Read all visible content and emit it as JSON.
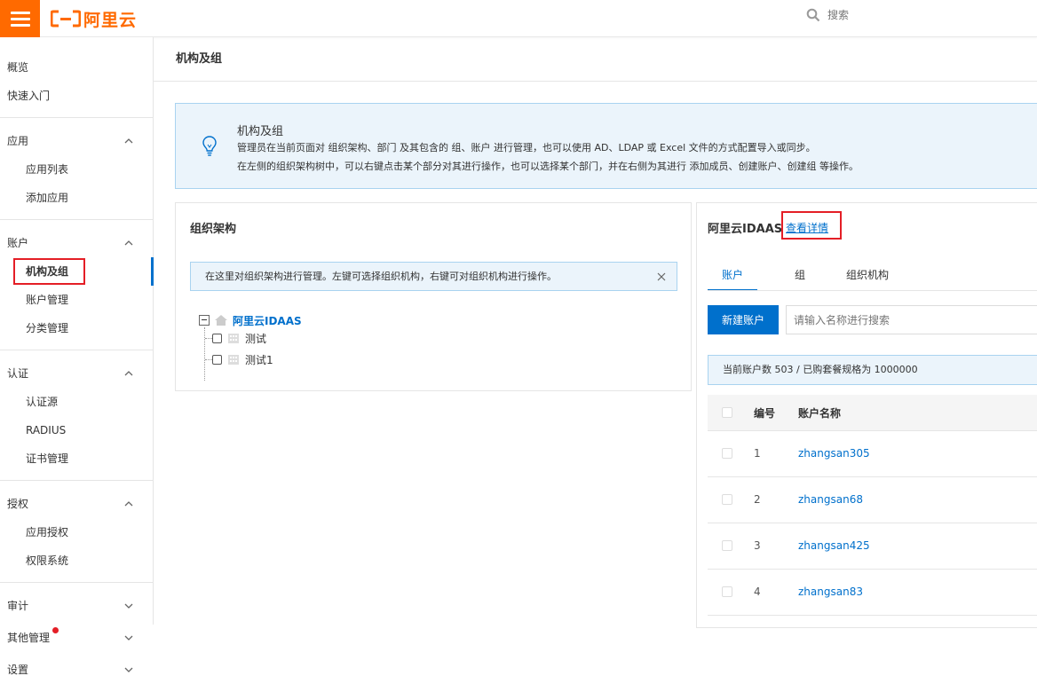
{
  "brand": {
    "name": "阿里云",
    "color": "#ff6a00"
  },
  "search": {
    "placeholder": "搜索"
  },
  "sidebar": {
    "top_items": [
      {
        "label": "概览"
      },
      {
        "label": "快速入门"
      }
    ],
    "groups": [
      {
        "label": "应用",
        "expanded": true,
        "items": [
          {
            "label": "应用列表"
          },
          {
            "label": "添加应用"
          }
        ]
      },
      {
        "label": "账户",
        "expanded": true,
        "items": [
          {
            "label": "机构及组",
            "active": true
          },
          {
            "label": "账户管理"
          },
          {
            "label": "分类管理"
          }
        ]
      },
      {
        "label": "认证",
        "expanded": true,
        "items": [
          {
            "label": "认证源"
          },
          {
            "label": "RADIUS"
          },
          {
            "label": "证书管理"
          }
        ]
      },
      {
        "label": "授权",
        "expanded": true,
        "items": [
          {
            "label": "应用授权"
          },
          {
            "label": "权限系统"
          }
        ]
      },
      {
        "label": "审计",
        "expanded": false,
        "items": []
      },
      {
        "label": "其他管理",
        "expanded": false,
        "items": [],
        "has_badge": true
      },
      {
        "label": "设置",
        "expanded": false,
        "items": []
      }
    ]
  },
  "page": {
    "title": "机构及组"
  },
  "notice": {
    "title": "机构及组",
    "line1": "管理员在当前页面对 组织架构、部门 及其包含的 组、账户 进行管理，也可以使用 AD、LDAP 或 Excel 文件的方式配置导入或同步。",
    "line2": "在左侧的组织架构树中，可以右键点击某个部分对其进行操作，也可以选择某个部门，并在右侧为其进行 添加成员、创建账户、创建组 等操作。"
  },
  "org_panel": {
    "title": "组织架构",
    "info": "在这里对组织架构进行管理。左键可选择组织机构，右键可对组织机构进行操作。",
    "tree": {
      "root": "阿里云IDAAS",
      "children": [
        {
          "label": "测试"
        },
        {
          "label": "测试1"
        }
      ]
    }
  },
  "account_panel": {
    "title": "阿里云IDAAS",
    "detail_link": "查看详情",
    "tabs": [
      {
        "label": "账户",
        "active": true
      },
      {
        "label": "组"
      },
      {
        "label": "组织机构"
      }
    ],
    "new_button": "新建账户",
    "search_placeholder": "请输入名称进行搜索",
    "count_text": "当前账户数 503 / 已购套餐规格为 1000000",
    "columns": {
      "num": "编号",
      "name": "账户名称"
    },
    "rows": [
      {
        "num": "1",
        "name": "zhangsan305"
      },
      {
        "num": "2",
        "name": "zhangsan68"
      },
      {
        "num": "3",
        "name": "zhangsan425"
      },
      {
        "num": "4",
        "name": "zhangsan83"
      }
    ]
  },
  "colors": {
    "primary": "#0070cc",
    "highlight_border": "#e41e26",
    "info_bg": "#ebf4fb"
  }
}
